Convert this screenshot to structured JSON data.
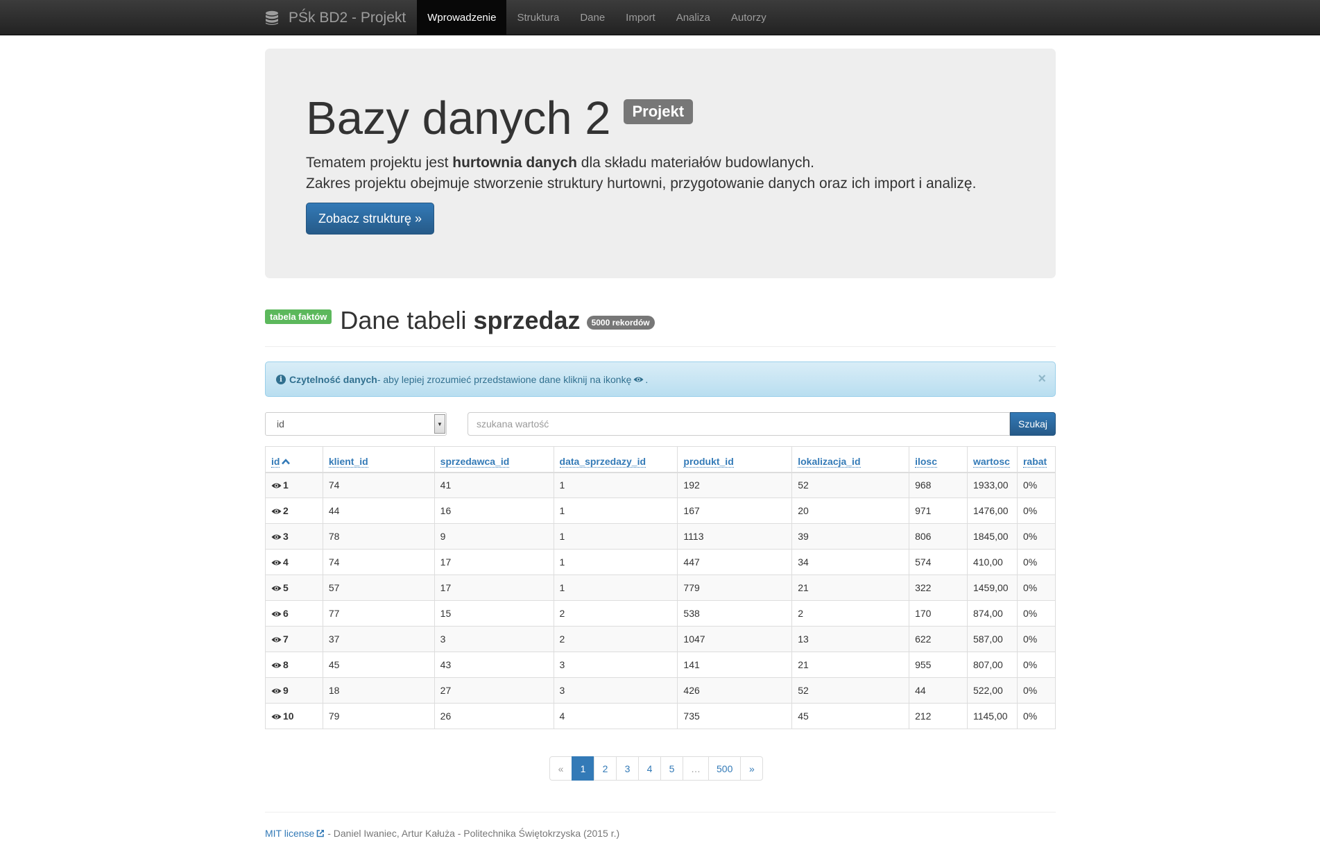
{
  "navbar": {
    "brand": "PŚk BD2 - Projekt",
    "items": [
      {
        "label": "Wprowadzenie",
        "active": true
      },
      {
        "label": "Struktura",
        "active": false
      },
      {
        "label": "Dane",
        "active": false
      },
      {
        "label": "Import",
        "active": false
      },
      {
        "label": "Analiza",
        "active": false
      },
      {
        "label": "Autorzy",
        "active": false
      }
    ]
  },
  "jumbotron": {
    "title": "Bazy danych 2",
    "badge": "Projekt",
    "line1_pre": "Tematem projektu jest ",
    "line1_bold": "hurtownia danych",
    "line1_post": " dla składu materiałów budowlanych.",
    "line2": "Zakres projektu obejmuje stworzenie struktury hurtowni, przygotowanie danych oraz ich import i analizę.",
    "button": "Zobacz strukturę »"
  },
  "section": {
    "label": "tabela faktów",
    "title_pre": "Dane tabeli ",
    "title_bold": "sprzedaz",
    "count_badge": "5000 rekordów"
  },
  "alert": {
    "bold": "Czytelność danych",
    "text": " - aby lepiej zrozumieć przedstawione dane kliknij na ikonkę",
    "end": ".",
    "close": "×"
  },
  "search": {
    "select_value": "id",
    "placeholder": "szukana wartość",
    "button": "Szukaj"
  },
  "table": {
    "columns": [
      "id",
      "klient_id",
      "sprzedawca_id",
      "data_sprzedazy_id",
      "produkt_id",
      "lokalizacja_id",
      "ilosc",
      "wartosc",
      "rabat"
    ],
    "rows": [
      [
        "1",
        "74",
        "41",
        "1",
        "192",
        "52",
        "968",
        "1933,00",
        "0%"
      ],
      [
        "2",
        "44",
        "16",
        "1",
        "167",
        "20",
        "971",
        "1476,00",
        "0%"
      ],
      [
        "3",
        "78",
        "9",
        "1",
        "1113",
        "39",
        "806",
        "1845,00",
        "0%"
      ],
      [
        "4",
        "74",
        "17",
        "1",
        "447",
        "34",
        "574",
        "410,00",
        "0%"
      ],
      [
        "5",
        "57",
        "17",
        "1",
        "779",
        "21",
        "322",
        "1459,00",
        "0%"
      ],
      [
        "6",
        "77",
        "15",
        "2",
        "538",
        "2",
        "170",
        "874,00",
        "0%"
      ],
      [
        "7",
        "37",
        "3",
        "2",
        "1047",
        "13",
        "622",
        "587,00",
        "0%"
      ],
      [
        "8",
        "45",
        "43",
        "3",
        "141",
        "21",
        "955",
        "807,00",
        "0%"
      ],
      [
        "9",
        "18",
        "27",
        "3",
        "426",
        "52",
        "44",
        "522,00",
        "0%"
      ],
      [
        "10",
        "79",
        "26",
        "4",
        "735",
        "45",
        "212",
        "1145,00",
        "0%"
      ]
    ]
  },
  "pagination": {
    "prev": "«",
    "pages": [
      "1",
      "2",
      "3",
      "4",
      "5"
    ],
    "ellipsis": "…",
    "last_page": "500",
    "next": "»",
    "current": "1"
  },
  "footer": {
    "license": "MIT license",
    "text": " - Daniel Iwaniec, Artur Kałuża - Politechnika Świętokrzyska (2015 r.)"
  },
  "colors": {
    "accent": "#337ab7",
    "navbar": "#222222",
    "success": "#5cb85c",
    "info_bg": "#d9edf7"
  },
  "icons": {
    "brand": "database-icon",
    "row_action": "eye-icon",
    "sort": "chevron-up-icon",
    "info": "info-circle-icon",
    "external": "external-link-icon"
  }
}
